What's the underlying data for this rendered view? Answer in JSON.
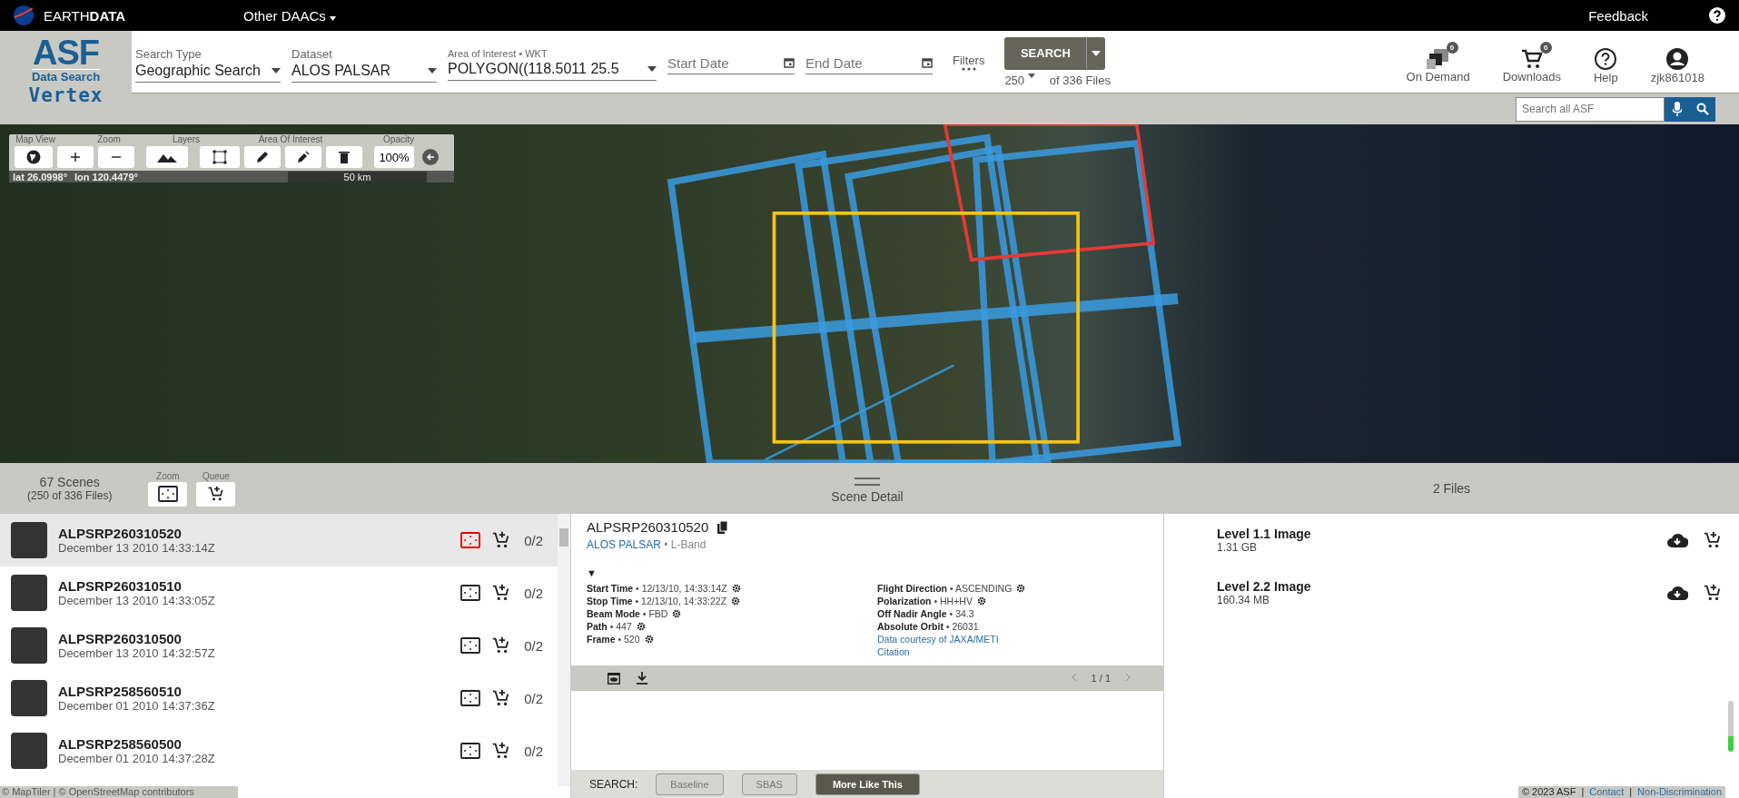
{
  "top_bar": {
    "brand": "EARTH**DATA**",
    "other_daacs": "Other DAACs",
    "feedback": "Feedback"
  },
  "logo": {
    "title": "ASF",
    "subtitle": "Data Search",
    "product": "Vertex"
  },
  "search_form": {
    "fields": [
      {
        "kind": "select",
        "label": "Search Type",
        "value": "Geographic Search"
      },
      {
        "kind": "select",
        "label": "Dataset",
        "value": "ALOS PALSAR"
      },
      {
        "kind": "wkt",
        "label": "Area of Interest • WKT",
        "value": "POLYGON((118.5011 25.5"
      },
      {
        "kind": "date",
        "placeholder": "Start Date"
      },
      {
        "kind": "date",
        "placeholder": "End Date"
      }
    ],
    "filters": "Filters",
    "search_button": "SEARCH",
    "max_results": "250",
    "results_of": "of 336 Files"
  },
  "header_actions": [
    {
      "kind": "on-demand",
      "label": "On Demand",
      "badge": "0"
    },
    {
      "kind": "cart",
      "label": "Downloads",
      "badge": "0"
    },
    {
      "kind": "help",
      "label": "Help"
    },
    {
      "kind": "account",
      "label": "zjk861018"
    }
  ],
  "site_search": {
    "placeholder": "Search all ASF"
  },
  "map_toolbar": {
    "groups": [
      "Map View",
      "Zoom",
      "Layers",
      "Area Of Interest",
      "Opacity"
    ],
    "opacity": "100%",
    "lat": "lat 26.0998°",
    "lon": "lon 120.4479°",
    "scale": "50 km"
  },
  "results_header": {
    "scenes": "67 Scenes",
    "files": "(250 of 336 Files)",
    "zoom_label": "Zoom",
    "queue_label": "Queue",
    "detail_title": "Scene Detail",
    "files_title": "2 Files"
  },
  "scenes": [
    {
      "name": "ALPSRP260310520",
      "date": "December 13 2010 14:33:14Z",
      "count": "0/2",
      "selected": true
    },
    {
      "name": "ALPSRP260310510",
      "date": "December 13 2010 14:33:05Z",
      "count": "0/2",
      "selected": false
    },
    {
      "name": "ALPSRP260310500",
      "date": "December 13 2010 14:32:57Z",
      "count": "0/2",
      "selected": false
    },
    {
      "name": "ALPSRP258560510",
      "date": "December 01 2010 14:37:36Z",
      "count": "0/2",
      "selected": false
    },
    {
      "name": "ALPSRP258560500",
      "date": "December 01 2010 14:37:28Z",
      "count": "0/2",
      "selected": false
    }
  ],
  "scene_detail": {
    "name": "ALPSRP260310520",
    "dataset": "ALOS PALSAR",
    "band": "• L-Band",
    "expand": "▼",
    "left": [
      {
        "label": "Start Time",
        "value": "• 12/13/10, 14:33:14Z",
        "gear": true
      },
      {
        "label": "Stop Time",
        "value": "• 12/13/10, 14:33:22Z",
        "gear": true
      },
      {
        "label": "Beam Mode",
        "value": "• FBD",
        "gear": true
      },
      {
        "label": "Path",
        "value": "• 447",
        "gear": true
      },
      {
        "label": "Frame",
        "value": "• 520",
        "gear": true
      }
    ],
    "right": [
      {
        "label": "Flight Direction",
        "value": "• ASCENDING",
        "gear": true
      },
      {
        "label": "Polarization",
        "value": "• HH+HV",
        "gear": true
      },
      {
        "label": "Off Nadir Angle",
        "value": "• 34.3",
        "gear": false
      },
      {
        "label": "Absolute Orbit",
        "value": "• 26031",
        "gear": false
      }
    ],
    "links": [
      "Data courtesy of JAXA/METI",
      "Citation"
    ],
    "pager": "1 / 1"
  },
  "search_more": {
    "label": "SEARCH:",
    "buttons": [
      {
        "label": "Baseline",
        "disabled": true
      },
      {
        "label": "SBAS",
        "disabled": true
      },
      {
        "label": "More Like This",
        "disabled": false
      }
    ]
  },
  "files": [
    {
      "name": "Level 1.1 Image",
      "size": "1.31 GB"
    },
    {
      "name": "Level 2.2 Image",
      "size": "160.34 MB"
    }
  ],
  "footer": {
    "map_attribution": "© MapTiler | © OpenStreetMap contributors",
    "copyright": "© 2023 ASF",
    "separator": "|",
    "links": [
      "Contact",
      "Non-Discrimination"
    ]
  }
}
